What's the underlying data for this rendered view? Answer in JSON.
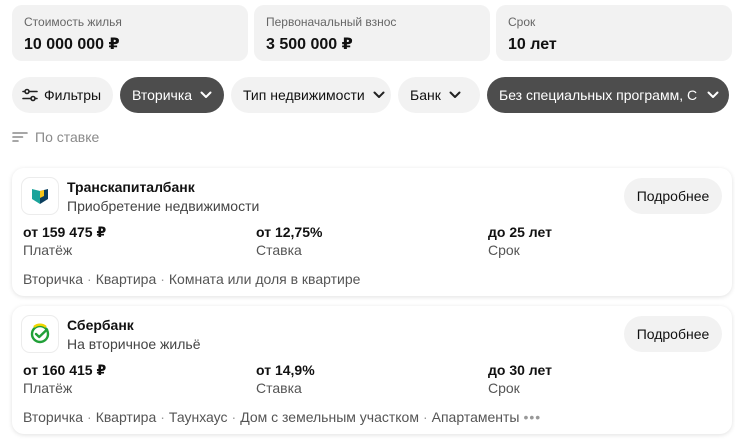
{
  "inputs": {
    "price": {
      "label": "Стоимость жилья",
      "value": "10 000 000 ₽"
    },
    "down_payment": {
      "label": "Первоначальный взнос",
      "value": "3 500 000 ₽"
    },
    "term": {
      "label": "Срок",
      "value": "10 лет"
    }
  },
  "filters": {
    "filters_label": "Фильтры",
    "secondary_label": "Вторичка",
    "type_label": "Тип недвижимости",
    "bank_label": "Банк",
    "programs_label": "Без специальных программ, С"
  },
  "sort": {
    "label": "По ставке"
  },
  "offers": [
    {
      "bank": "Транскапиталбанк",
      "program": "Приобретение недвижимости",
      "more_label": "Подробнее",
      "payment": {
        "value": "от 159 475 ₽",
        "label": "Платёж"
      },
      "rate": {
        "value": "от 12,75%",
        "label": "Ставка"
      },
      "term": {
        "value": "до 25 лет",
        "label": "Срок"
      },
      "tags": [
        "Вторичка",
        "Квартира",
        "Комната или доля в квартире"
      ],
      "logo_colors": [
        "#1aa39a",
        "#0b3f5e"
      ]
    },
    {
      "bank": "Сбербанк",
      "program": "На вторичное жильё",
      "more_label": "Подробнее",
      "payment": {
        "value": "от 160 415 ₽",
        "label": "Платёж"
      },
      "rate": {
        "value": "от 14,9%",
        "label": "Ставка"
      },
      "term": {
        "value": "до 30 лет",
        "label": "Срок"
      },
      "tags": [
        "Вторичка",
        "Квартира",
        "Таунхаус",
        "Дом с земельным участком",
        "Апартаменты"
      ],
      "more_tags_icon": "ellipsis-icon",
      "logo_colors": [
        "#21a038",
        "#f2d600"
      ]
    }
  ],
  "colors": {
    "chip_dark": "#4d4d4d",
    "chip_light": "#f2f2f2",
    "input_bg": "#f2f2f2"
  }
}
